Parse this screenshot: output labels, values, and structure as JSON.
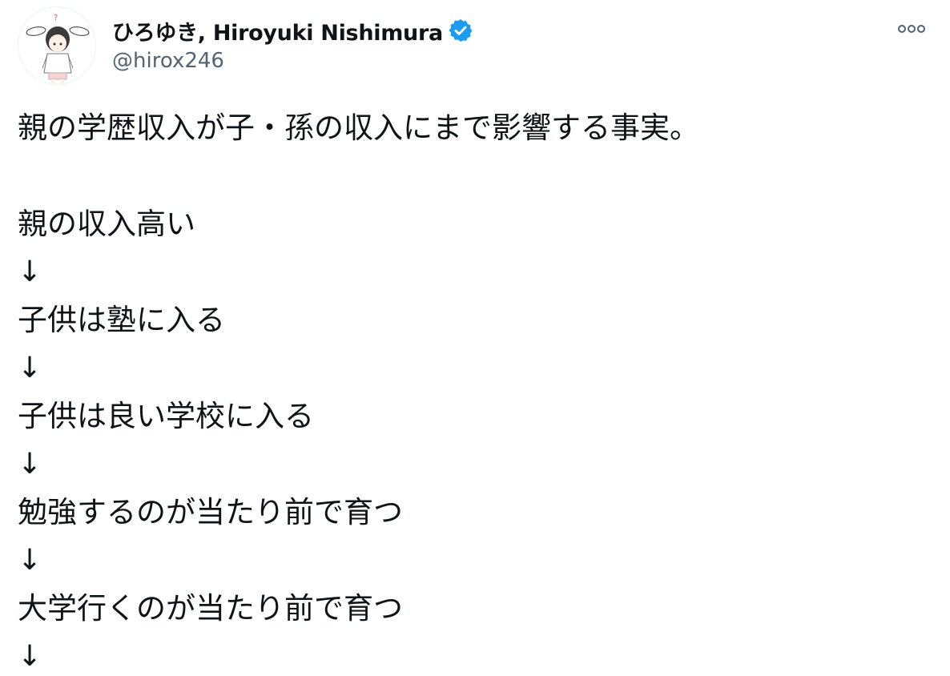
{
  "tweet": {
    "author": {
      "display_name": "ひろゆき, Hiroyuki Nishimura",
      "handle": "@hirox246",
      "verified": true,
      "avatar_icon": "avatar-bunny-ears-character"
    },
    "more_icon": "more-options-icon",
    "accent_color": "#1d9bf0",
    "text_lines": [
      "親の学歴収入が子・孫の収入にまで影響する事実。",
      "",
      "親の収入高い",
      "↓",
      "子供は塾に入る",
      "↓",
      "子供は良い学校に入る",
      "↓",
      "勉強するのが当たり前で育つ",
      "↓",
      "大学行くのが当たり前で育つ",
      "↓"
    ]
  }
}
